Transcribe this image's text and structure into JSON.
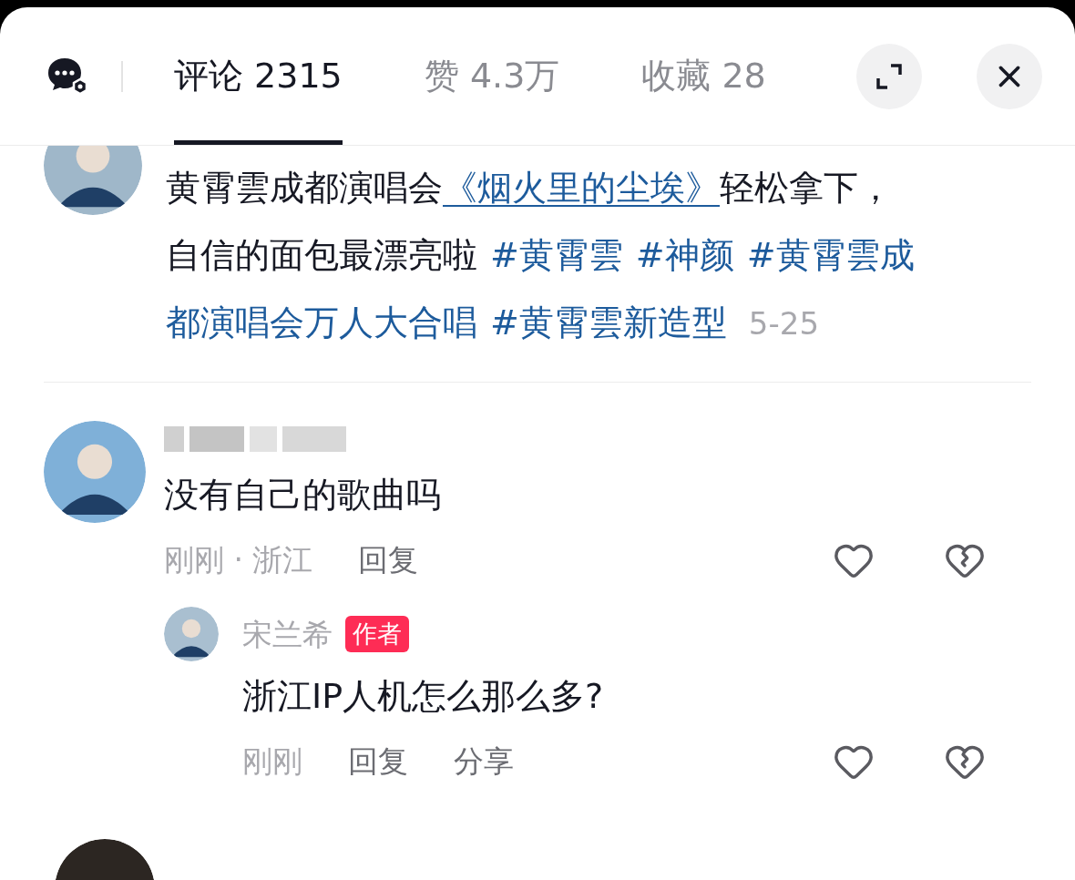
{
  "tabs": [
    {
      "label": "评论 2315",
      "selected": true
    },
    {
      "label": "赞 4.3万",
      "selected": false
    },
    {
      "label": "收藏 28",
      "selected": false
    }
  ],
  "post": {
    "lines": [
      [
        {
          "kind": "plain",
          "text": "黄霄雲成都演唱会"
        },
        {
          "kind": "link",
          "text": "《烟火里的尘埃》"
        },
        {
          "kind": "plain",
          "text": "轻松拿下，"
        }
      ],
      [
        {
          "kind": "plain",
          "text": "自信的面包最漂亮啦"
        },
        {
          "kind": "hashtag",
          "text": "#黄霄雲"
        },
        {
          "kind": "hashtag",
          "text": "#神颜"
        },
        {
          "kind": "hashtag",
          "text": "#黄霄雲成"
        }
      ],
      [
        {
          "kind": "hashtag",
          "text": "都演唱会万人大合唱"
        },
        {
          "kind": "hashtag",
          "text": "#黄霄雲新造型"
        },
        {
          "kind": "date",
          "text": "5-25"
        }
      ]
    ]
  },
  "comments": [
    {
      "text": "没有自己的歌曲吗",
      "time": "刚刚 · 浙江",
      "actions": [
        "回复"
      ],
      "replies": [
        {
          "name": "宋兰希",
          "badge": "作者",
          "text": "浙江IP人机怎么那么多?",
          "time": "刚刚",
          "actions": [
            "回复",
            "分享"
          ]
        }
      ]
    }
  ]
}
